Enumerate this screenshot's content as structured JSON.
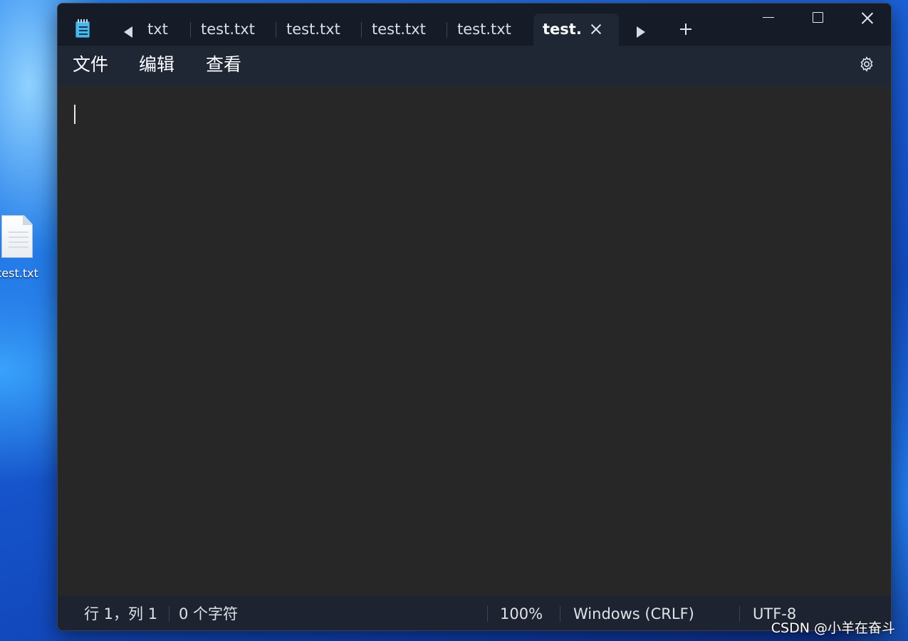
{
  "desktop": {
    "icon_label": "test.txt"
  },
  "window": {
    "tabs": [
      {
        "label": "txt"
      },
      {
        "label": "test.txt"
      },
      {
        "label": "test.txt"
      },
      {
        "label": "test.txt"
      },
      {
        "label": "test.txt"
      }
    ],
    "active_tab": {
      "label": "test."
    },
    "menu": {
      "file": "文件",
      "edit": "编辑",
      "view": "查看"
    },
    "editor": {
      "content": ""
    },
    "status": {
      "position": "行 1，列 1",
      "char_count": "0 个字符",
      "zoom": "100%",
      "line_ending": "Windows (CRLF)",
      "encoding": "UTF-8"
    }
  },
  "watermark": "CSDN @小羊在奋斗",
  "colors": {
    "titlebar_bg": "#151b27",
    "menubar_bg": "#1f2634",
    "editor_bg": "#272727",
    "statusbar_bg": "#1d2330",
    "text": "#ffffff"
  }
}
